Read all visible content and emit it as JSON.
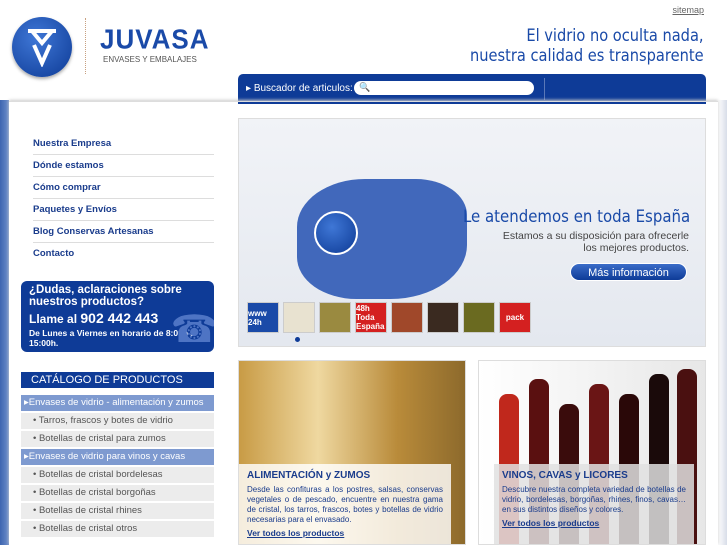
{
  "header": {
    "sitemap": "sitemap",
    "brand": "JUVASA",
    "brand_sub": "ENVASES Y EMBALAJES",
    "slogan_line1": "El vidrio no oculta nada,",
    "slogan_line2": "nuestra calidad es transparente"
  },
  "search": {
    "label": "Buscador de articulos:",
    "value": ""
  },
  "nav": [
    "Nuestra Empresa",
    "Dónde estamos",
    "Cómo comprar",
    "Paquetes y Envíos",
    "Blog Conservas Artesanas",
    "Contacto"
  ],
  "help": {
    "question": "¿Dudas, aclaraciones sobre nuestros productos?",
    "call": "Llame al",
    "phone": "902 442 443",
    "hours": "De Lunes a Viernes en horario de 8:00h a 15:00h."
  },
  "catalog": {
    "title": "CATÁLOGO DE PRODUCTOS",
    "items": [
      {
        "label": "Envases de vidrio - alimentación y zumos",
        "type": "main"
      },
      {
        "label": "Tarros, frascos y botes de vidrio",
        "type": "sub"
      },
      {
        "label": "Botellas de cristal para zumos",
        "type": "sub"
      },
      {
        "label": "Envases de vidrio para vinos y cavas",
        "type": "main"
      },
      {
        "label": "Botellas de cristal bordelesas",
        "type": "sub"
      },
      {
        "label": "Botellas de cristal borgoñas",
        "type": "sub"
      },
      {
        "label": "Botellas de cristal rhines",
        "type": "sub"
      },
      {
        "label": "Botellas de cristal otros",
        "type": "sub"
      }
    ]
  },
  "banner": {
    "title": "Le atendemos en toda España",
    "text_line1": "Estamos a su disposición para ofrecerle",
    "text_line2": "los mejores productos.",
    "button": "Más información",
    "thumbs": [
      {
        "label": "www 24h",
        "color": "#1a4aa8"
      },
      {
        "label": "",
        "color": "#e8e2d0"
      },
      {
        "label": "",
        "color": "#9a8a40"
      },
      {
        "label": "48h Toda España",
        "color": "#d42020"
      },
      {
        "label": "",
        "color": "#a0482a"
      },
      {
        "label": "",
        "color": "#3a2a20"
      },
      {
        "label": "",
        "color": "#6a6a20"
      },
      {
        "label": "pack",
        "color": "#d42020"
      }
    ]
  },
  "cards": [
    {
      "title": "ALIMENTACIÓN y ZUMOS",
      "text": "Desde las confituras a los postres, salsas, conservas vegetales o de pescado, encuentre en nuestra gama de cristal, los tarros, frascos, botes y botellas de vidrio necesarias para el envasado.",
      "link": "Ver todos los productos"
    },
    {
      "title": "VINOS, CAVAS y LICORES",
      "text": "Descubre nuestra completa variedad de botellas de vidrio, bordelesas, borgoñas, rhines, finos, cavas… en sus distintos diseños y colores.",
      "link": "Ver todos los productos"
    }
  ]
}
